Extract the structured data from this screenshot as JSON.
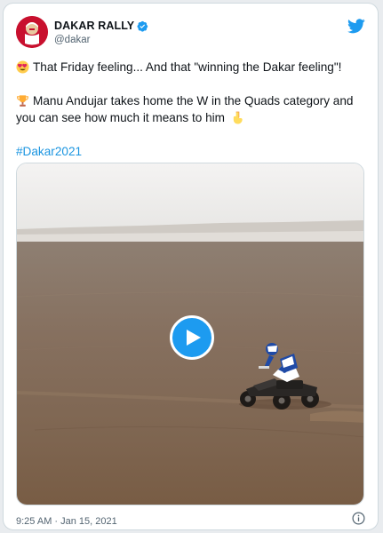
{
  "author": {
    "display_name": "DAKAR RALLY",
    "handle": "@dakar",
    "verified": true,
    "avatar_icon": "dakar-logo-icon"
  },
  "tweet": {
    "line1": "That Friday feeling... And that \"winning the Dakar feeling\"!",
    "line2": "Manu Andujar takes home the W in the Quads category and you can see how much it means to him",
    "hashtag": "#Dakar2021",
    "emoji_line1": "heart-eyes-emoji",
    "emoji_line2_start": "trophy-emoji",
    "emoji_line2_end": "pointing-down-emoji"
  },
  "media": {
    "type": "video",
    "play_icon": "play-icon"
  },
  "footer": {
    "timestamp": "9:25 AM · Jan 15, 2021",
    "info_icon": "info-icon"
  },
  "colors": {
    "accent": "#1d9bf0",
    "hashtag": "#1b95e0",
    "brand_red": "#c8102e",
    "text": "#0f1419",
    "muted": "#536471"
  }
}
